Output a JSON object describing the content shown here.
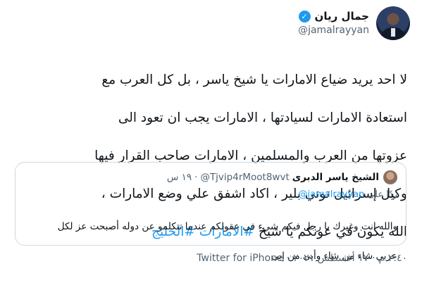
{
  "author": {
    "display_name": "جمال ريان",
    "handle": "@jamalrayyan",
    "verified": true
  },
  "tweet": {
    "lines": [
      "لا احد يريد ضياع الامارات يا شيخ ياسر ، بل كل العرب مع",
      "استعادة الامارات لسيادتها ، الامارات يجب ان  تعود الى",
      "عزوتها من العرب والمسلمين ، الامارات صاحب القرار فيها",
      "وكيل إسرائيل توني بلير ، اكاد اشفق علي وضع الامارات ،",
      "الله يكون في عونكم يا شيخ"
    ],
    "hashtags": "#الامارات #الخليج"
  },
  "quoted": {
    "display_name": "الشيخ ياسر الدبرى",
    "handle": "@Tjvip4rMoot8wvt",
    "separator": "·",
    "time": "١٩ س",
    "reply_prefix": "ردًا على",
    "reply_to": "@jamalrayyan",
    "text_lines": [
      "والله انت وغيرك يا رجل فيكم شيء في عقولكم عندما تتكلمو عن دوله أصبحت عز لكل",
      "عربي شاء من شاء وأبى من إبى"
    ]
  },
  "meta": {
    "time": "٢:٤٠ م",
    "separator1": "·",
    "date": "١٧ أغسطس ٢٠٢١",
    "separator2": "·",
    "source": "Twitter for iPhone"
  },
  "colors": {
    "link": "#1d9bf0",
    "secondary_text": "#536471",
    "border": "#cfd9de"
  }
}
